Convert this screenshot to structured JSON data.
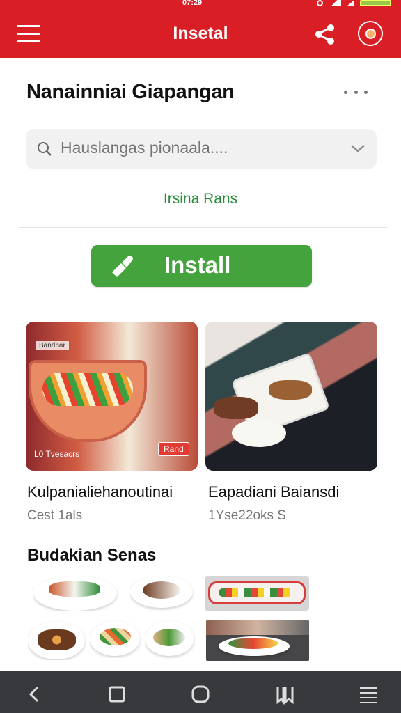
{
  "status_bar": {
    "time": "07:29"
  },
  "header": {
    "title": "Insetal",
    "share_icon": "share-icon",
    "profile_icon": "profile-icon"
  },
  "main": {
    "heading": "Nanainniai Giapangan",
    "search": {
      "placeholder": "Hauslangas pionaala...."
    },
    "link": "Irsina Rans",
    "install_label": "Install",
    "cards": [
      {
        "image_badge": "Bandbar",
        "bottom_left_label": "L0 Tvesacrs",
        "tag": "Rand",
        "label": "Kulpanialiehanoutinai",
        "meta": "Cest 1als"
      },
      {
        "label": "Eapadiani Baiansdi",
        "meta": "1Yse22oks S"
      }
    ],
    "section_title": "Budakian Senas"
  },
  "bottom_nav": {
    "items": [
      "back-icon",
      "recent-apps-icon",
      "home-icon",
      "bookmarks-icon",
      "menu-icon"
    ]
  },
  "colors": {
    "primary": "#d91e26",
    "accent_green": "#44a33d",
    "dark_nav": "#37393d"
  }
}
